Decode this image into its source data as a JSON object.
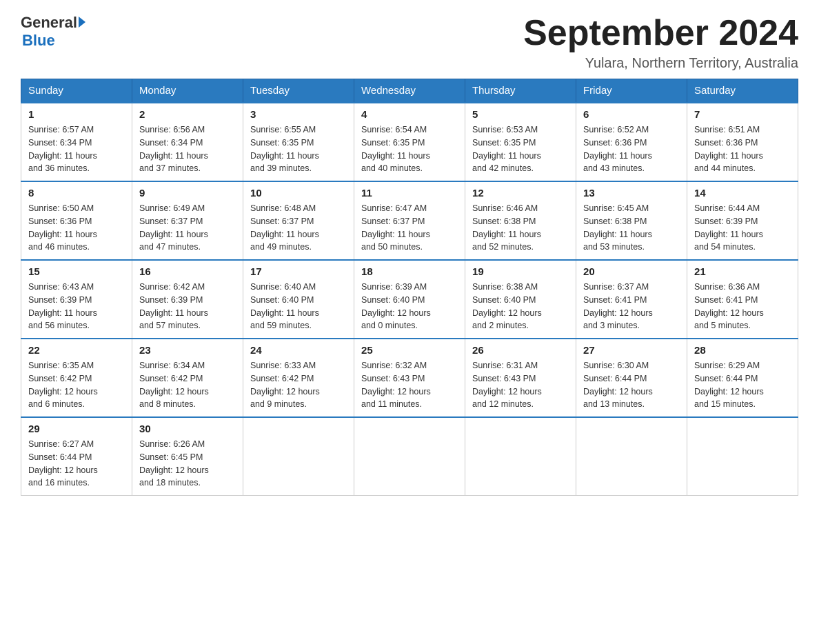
{
  "logo": {
    "general": "General",
    "blue": "Blue"
  },
  "header": {
    "month_year": "September 2024",
    "location": "Yulara, Northern Territory, Australia"
  },
  "weekdays": [
    "Sunday",
    "Monday",
    "Tuesday",
    "Wednesday",
    "Thursday",
    "Friday",
    "Saturday"
  ],
  "weeks": [
    [
      {
        "day": "1",
        "sunrise": "6:57 AM",
        "sunset": "6:34 PM",
        "daylight": "11 hours and 36 minutes."
      },
      {
        "day": "2",
        "sunrise": "6:56 AM",
        "sunset": "6:34 PM",
        "daylight": "11 hours and 37 minutes."
      },
      {
        "day": "3",
        "sunrise": "6:55 AM",
        "sunset": "6:35 PM",
        "daylight": "11 hours and 39 minutes."
      },
      {
        "day": "4",
        "sunrise": "6:54 AM",
        "sunset": "6:35 PM",
        "daylight": "11 hours and 40 minutes."
      },
      {
        "day": "5",
        "sunrise": "6:53 AM",
        "sunset": "6:35 PM",
        "daylight": "11 hours and 42 minutes."
      },
      {
        "day": "6",
        "sunrise": "6:52 AM",
        "sunset": "6:36 PM",
        "daylight": "11 hours and 43 minutes."
      },
      {
        "day": "7",
        "sunrise": "6:51 AM",
        "sunset": "6:36 PM",
        "daylight": "11 hours and 44 minutes."
      }
    ],
    [
      {
        "day": "8",
        "sunrise": "6:50 AM",
        "sunset": "6:36 PM",
        "daylight": "11 hours and 46 minutes."
      },
      {
        "day": "9",
        "sunrise": "6:49 AM",
        "sunset": "6:37 PM",
        "daylight": "11 hours and 47 minutes."
      },
      {
        "day": "10",
        "sunrise": "6:48 AM",
        "sunset": "6:37 PM",
        "daylight": "11 hours and 49 minutes."
      },
      {
        "day": "11",
        "sunrise": "6:47 AM",
        "sunset": "6:37 PM",
        "daylight": "11 hours and 50 minutes."
      },
      {
        "day": "12",
        "sunrise": "6:46 AM",
        "sunset": "6:38 PM",
        "daylight": "11 hours and 52 minutes."
      },
      {
        "day": "13",
        "sunrise": "6:45 AM",
        "sunset": "6:38 PM",
        "daylight": "11 hours and 53 minutes."
      },
      {
        "day": "14",
        "sunrise": "6:44 AM",
        "sunset": "6:39 PM",
        "daylight": "11 hours and 54 minutes."
      }
    ],
    [
      {
        "day": "15",
        "sunrise": "6:43 AM",
        "sunset": "6:39 PM",
        "daylight": "11 hours and 56 minutes."
      },
      {
        "day": "16",
        "sunrise": "6:42 AM",
        "sunset": "6:39 PM",
        "daylight": "11 hours and 57 minutes."
      },
      {
        "day": "17",
        "sunrise": "6:40 AM",
        "sunset": "6:40 PM",
        "daylight": "11 hours and 59 minutes."
      },
      {
        "day": "18",
        "sunrise": "6:39 AM",
        "sunset": "6:40 PM",
        "daylight": "12 hours and 0 minutes."
      },
      {
        "day": "19",
        "sunrise": "6:38 AM",
        "sunset": "6:40 PM",
        "daylight": "12 hours and 2 minutes."
      },
      {
        "day": "20",
        "sunrise": "6:37 AM",
        "sunset": "6:41 PM",
        "daylight": "12 hours and 3 minutes."
      },
      {
        "day": "21",
        "sunrise": "6:36 AM",
        "sunset": "6:41 PM",
        "daylight": "12 hours and 5 minutes."
      }
    ],
    [
      {
        "day": "22",
        "sunrise": "6:35 AM",
        "sunset": "6:42 PM",
        "daylight": "12 hours and 6 minutes."
      },
      {
        "day": "23",
        "sunrise": "6:34 AM",
        "sunset": "6:42 PM",
        "daylight": "12 hours and 8 minutes."
      },
      {
        "day": "24",
        "sunrise": "6:33 AM",
        "sunset": "6:42 PM",
        "daylight": "12 hours and 9 minutes."
      },
      {
        "day": "25",
        "sunrise": "6:32 AM",
        "sunset": "6:43 PM",
        "daylight": "12 hours and 11 minutes."
      },
      {
        "day": "26",
        "sunrise": "6:31 AM",
        "sunset": "6:43 PM",
        "daylight": "12 hours and 12 minutes."
      },
      {
        "day": "27",
        "sunrise": "6:30 AM",
        "sunset": "6:44 PM",
        "daylight": "12 hours and 13 minutes."
      },
      {
        "day": "28",
        "sunrise": "6:29 AM",
        "sunset": "6:44 PM",
        "daylight": "12 hours and 15 minutes."
      }
    ],
    [
      {
        "day": "29",
        "sunrise": "6:27 AM",
        "sunset": "6:44 PM",
        "daylight": "12 hours and 16 minutes."
      },
      {
        "day": "30",
        "sunrise": "6:26 AM",
        "sunset": "6:45 PM",
        "daylight": "12 hours and 18 minutes."
      },
      null,
      null,
      null,
      null,
      null
    ]
  ],
  "labels": {
    "sunrise": "Sunrise:",
    "sunset": "Sunset:",
    "daylight": "Daylight:"
  }
}
